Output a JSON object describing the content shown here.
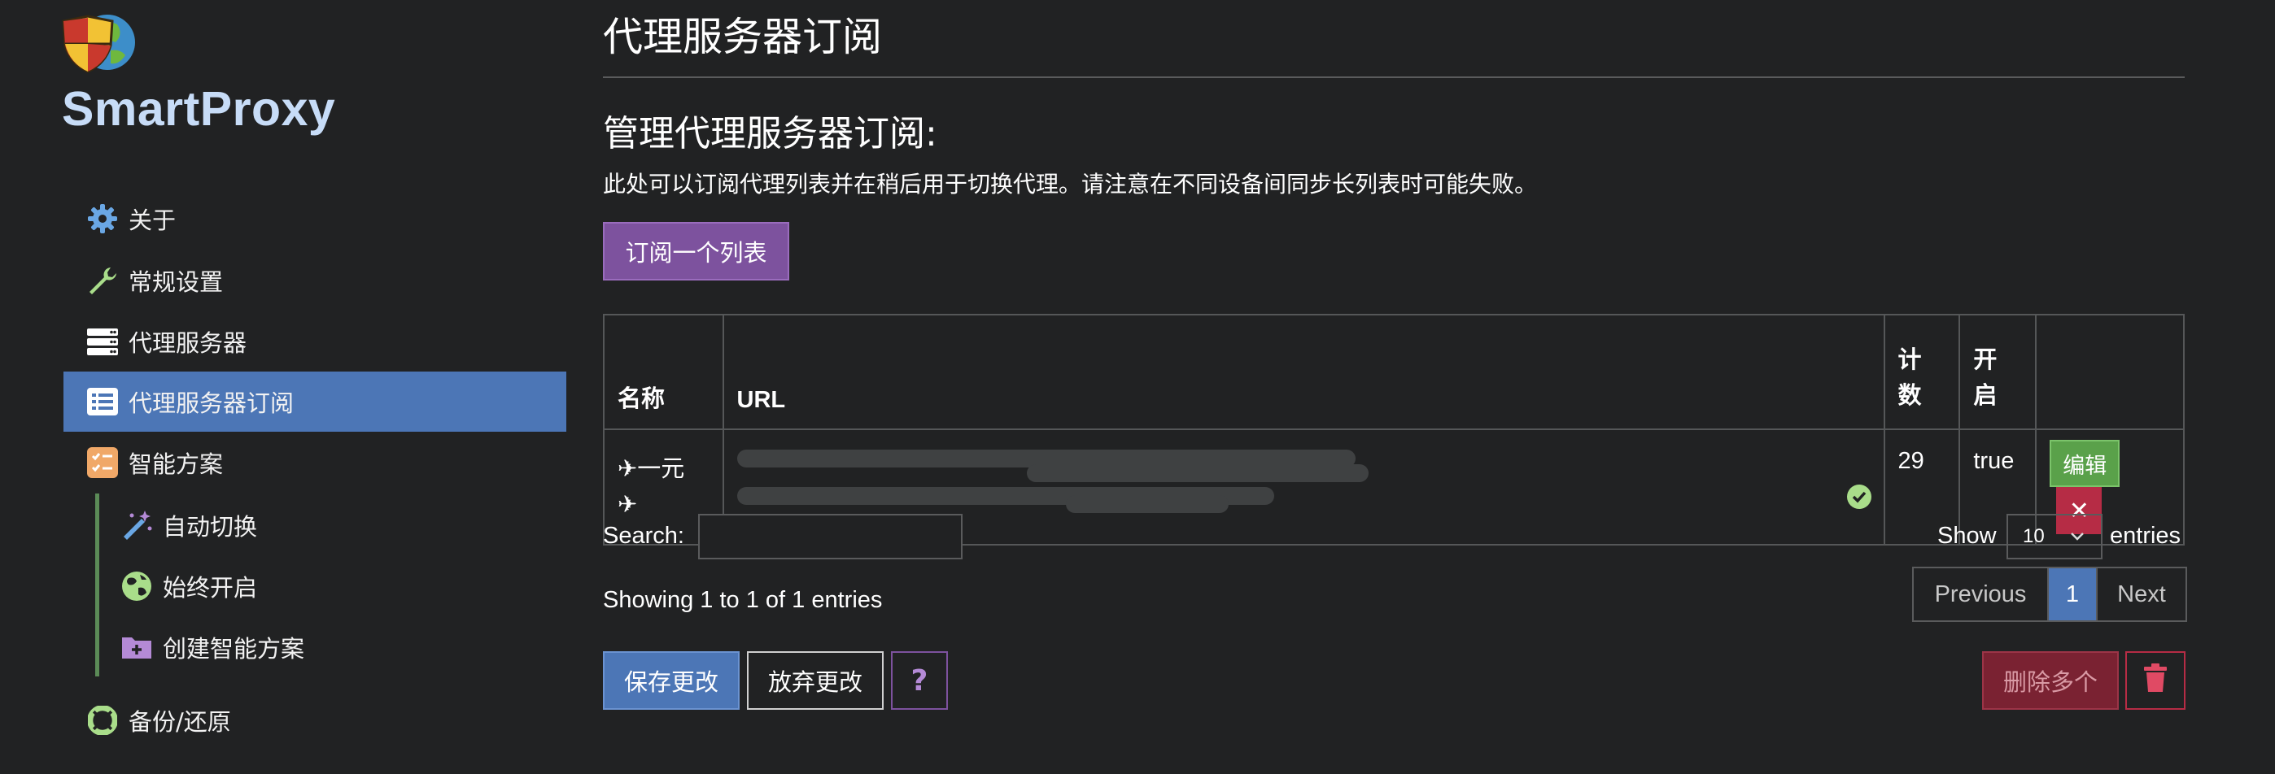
{
  "app": {
    "name": "SmartProxy"
  },
  "sidebar": {
    "items": [
      {
        "label": "关于",
        "icon": "gear-icon"
      },
      {
        "label": "常规设置",
        "icon": "wrench-icon"
      },
      {
        "label": "代理服务器",
        "icon": "server-icon"
      },
      {
        "label": "代理服务器订阅",
        "icon": "list-icon",
        "active": true
      },
      {
        "label": "智能方案",
        "icon": "checklist-icon"
      },
      {
        "label": "自动切换",
        "icon": "magic-wand-icon"
      },
      {
        "label": "始终开启",
        "icon": "globe-icon"
      },
      {
        "label": "创建智能方案",
        "icon": "folder-plus-icon"
      },
      {
        "label": "备份/还原",
        "icon": "lifebuoy-icon"
      }
    ]
  },
  "main": {
    "title": "代理服务器订阅",
    "section_title": "管理代理服务器订阅:",
    "description": "此处可以订阅代理列表并在稍后用于切换代理。请注意在不同设备间同步长列表时可能失败。",
    "subscribe_button": "订阅一个列表",
    "table": {
      "headers": {
        "name": "名称",
        "url": "URL",
        "count_1": "计",
        "count_2": "数",
        "enabled_1": "开",
        "enabled_2": "启"
      },
      "rows": [
        {
          "name_line1": "✈一元",
          "name_line2": "✈",
          "count": "29",
          "enabled": "true",
          "edit": "编辑",
          "delete": "✕"
        }
      ]
    },
    "search_label": "Search:",
    "search_value": "",
    "show_label": "Show",
    "entries_label": "entries",
    "page_size": "10",
    "info": "Showing 1 to 1 of 1 entries",
    "pager": {
      "previous": "Previous",
      "current": "1",
      "next": "Next"
    },
    "footer": {
      "save": "保存更改",
      "discard": "放弃更改",
      "help": "?",
      "delete_many": "删除多个"
    }
  },
  "colors": {
    "accent": "#4c76b6",
    "purple": "#7d529e",
    "danger": "#b62c45",
    "success": "#5aa14a"
  }
}
